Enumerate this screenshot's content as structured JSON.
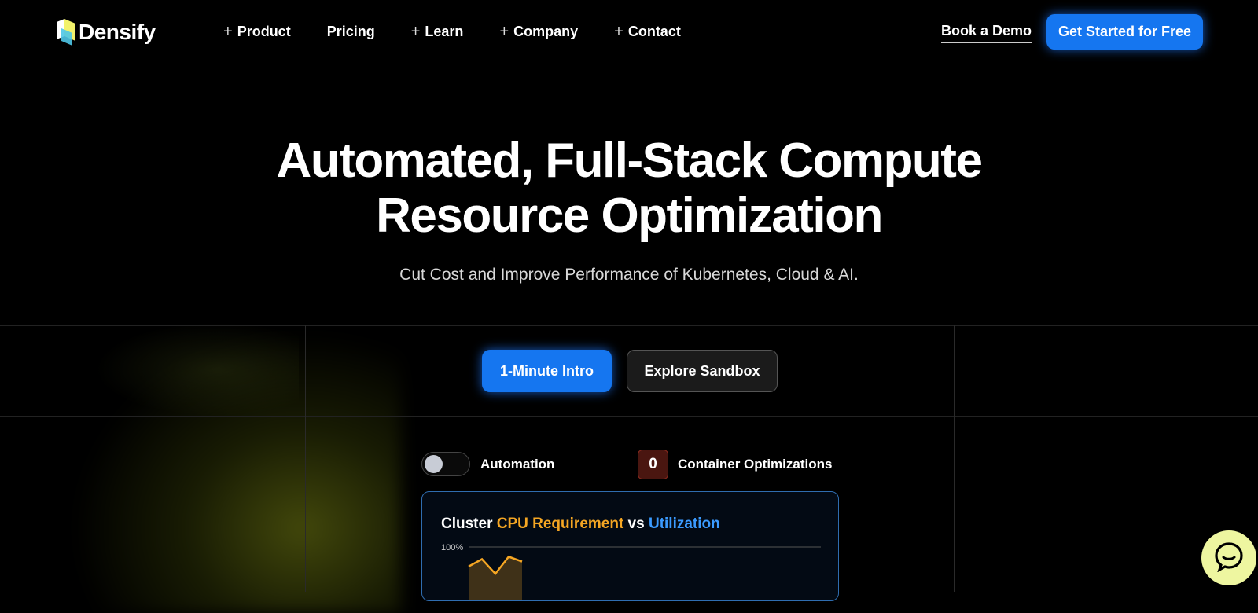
{
  "header": {
    "logo_text": "Densify",
    "nav": [
      {
        "label": "Product",
        "has_plus": true
      },
      {
        "label": "Pricing",
        "has_plus": false
      },
      {
        "label": "Learn",
        "has_plus": true
      },
      {
        "label": "Company",
        "has_plus": true
      },
      {
        "label": "Contact",
        "has_plus": true
      }
    ],
    "book_demo": "Book a Demo",
    "cta": "Get Started for Free"
  },
  "hero": {
    "title_line1": "Automated, Full-Stack Compute",
    "title_line2": "Resource Optimization",
    "subtitle": "Cut Cost and Improve Performance of Kubernetes, Cloud & AI.",
    "btn_intro": "1-Minute Intro",
    "btn_sandbox": "Explore Sandbox"
  },
  "controls": {
    "automation_label": "Automation",
    "automation_on": false,
    "optimizations_count": "0",
    "optimizations_label": "Container Optimizations"
  },
  "chart_card": {
    "title_part1": "Cluster ",
    "title_part2": "CPU Requirement",
    "title_part3": " vs ",
    "title_part4": "Utilization",
    "y_tick": "100%"
  },
  "chart_data": {
    "type": "area",
    "series": [
      {
        "name": "CPU Requirement",
        "values": [
          92,
          95,
          89,
          96,
          94
        ]
      }
    ],
    "ylim": [
      0,
      100
    ],
    "grid": true
  },
  "colors": {
    "accent_blue": "#1576f0",
    "orange": "#f5a623",
    "utilization_blue": "#3b9bff",
    "chat_bg": "#eef6a0"
  },
  "icons": {
    "chat": "chat-bubble-icon",
    "logo": "densify-logo-icon"
  }
}
